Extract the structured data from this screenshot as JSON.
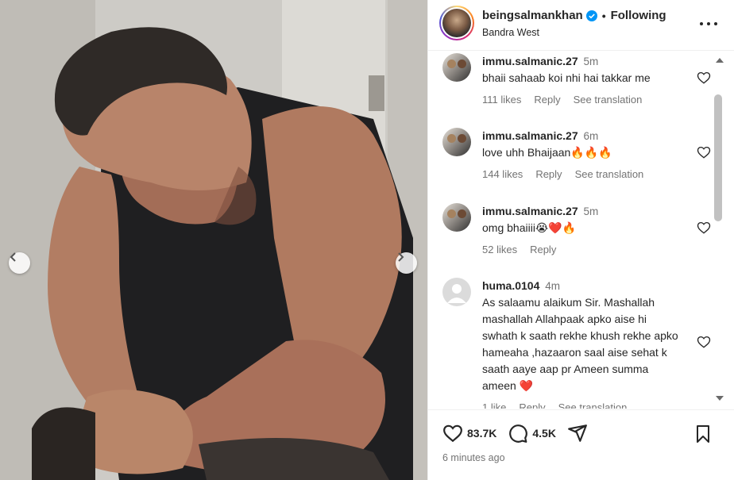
{
  "post": {
    "username": "beingsalmankhan",
    "follow_status": "Following",
    "location": "Bandra West",
    "verified": true
  },
  "comments": [
    {
      "username": "immu.salmanic.27",
      "time": "5m",
      "text": "bhaii sahaab koi nhi hai takkar me",
      "likes": "111 likes",
      "reply": "Reply",
      "translate": "See translation",
      "avatar": "photo"
    },
    {
      "username": "immu.salmanic.27",
      "time": "6m",
      "text": "love uhh Bhaijaan🔥🔥🔥",
      "likes": "144 likes",
      "reply": "Reply",
      "translate": "See translation",
      "avatar": "photo"
    },
    {
      "username": "immu.salmanic.27",
      "time": "5m",
      "text": "omg bhaiiii😭❤️🔥",
      "likes": "52 likes",
      "reply": "Reply",
      "translate": "",
      "avatar": "photo"
    },
    {
      "username": "huma.0104",
      "time": "4m",
      "text": "As salaamu alaikum Sir. Mashallah mashallah Allahpaak apko aise hi swhath k saath rekhe khush rekhe apko hameaha ,hazaaron saal aise sehat k saath aaye aap pr Ameen summa ameen ❤️",
      "likes": "1 like",
      "reply": "Reply",
      "translate": "See translation",
      "avatar": "default"
    }
  ],
  "stats": {
    "likes": "83.7K",
    "comments": "4.5K"
  },
  "time_ago": "6 minutes ago",
  "colors": {
    "text": "#262626",
    "muted": "#737373",
    "verified": "#0095f6",
    "border": "#efefef"
  },
  "icons": {
    "prev": "chevron-left-icon",
    "next": "chevron-right-icon",
    "like": "heart-icon",
    "comment": "comment-icon",
    "share": "share-icon",
    "save": "bookmark-icon",
    "more": "more-icon"
  }
}
